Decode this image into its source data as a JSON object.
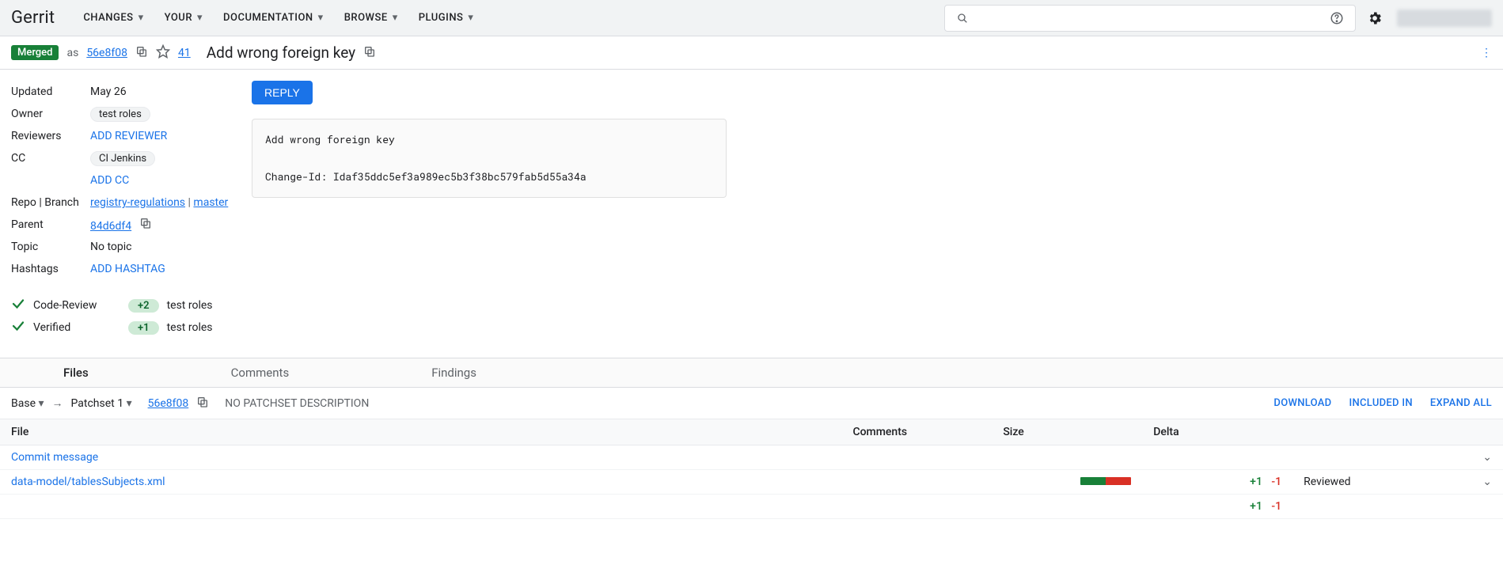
{
  "header": {
    "brand": "Gerrit",
    "nav": [
      "CHANGES",
      "YOUR",
      "DOCUMENTATION",
      "BROWSE",
      "PLUGINS"
    ],
    "search_placeholder": ""
  },
  "change": {
    "status": "Merged",
    "as_prefix": "as",
    "commit_short": "56e8f08",
    "star_count": "41",
    "title": "Add wrong foreign key"
  },
  "meta": {
    "updated_label": "Updated",
    "updated_value": "May 26",
    "owner_label": "Owner",
    "owner_value": "test roles",
    "reviewers_label": "Reviewers",
    "reviewers_action": "ADD REVIEWER",
    "cc_label": "CC",
    "cc_value": "CI Jenkins",
    "cc_action": "ADD CC",
    "repo_label": "Repo | Branch",
    "repo_value": "registry-regulations",
    "branch_value": "master",
    "parent_label": "Parent",
    "parent_value": "84d6df4",
    "topic_label": "Topic",
    "topic_value": "No topic",
    "hashtags_label": "Hashtags",
    "hashtags_action": "ADD HASHTAG"
  },
  "votes": {
    "code_review_label": "Code-Review",
    "code_review_score": "+2",
    "code_review_by": "test roles",
    "verified_label": "Verified",
    "verified_score": "+1",
    "verified_by": "test roles"
  },
  "reply_label": "REPLY",
  "commit_message": "Add wrong foreign key\n\nChange-Id: Idaf35ddc5ef3a989ec5b3f38bc579fab5d55a34a",
  "tabs": {
    "files": "Files",
    "comments": "Comments",
    "findings": "Findings"
  },
  "patchset": {
    "base_label": "Base",
    "patchset_label": "Patchset 1",
    "sha": "56e8f08",
    "no_desc": "NO PATCHSET DESCRIPTION",
    "actions": {
      "download": "DOWNLOAD",
      "included": "INCLUDED IN",
      "expand": "EXPAND ALL"
    }
  },
  "files_table": {
    "headers": {
      "file": "File",
      "comments": "Comments",
      "size": "Size",
      "delta": "Delta"
    },
    "rows": [
      {
        "name": "Commit message",
        "comments": "",
        "size_add_pct": 0,
        "size_del_pct": 0,
        "delta_add": "",
        "delta_del": "",
        "status": ""
      },
      {
        "name": "data-model/tablesSubjects.xml",
        "comments": "",
        "size_add_pct": 50,
        "size_del_pct": 50,
        "delta_add": "+1",
        "delta_del": "-1",
        "status": "Reviewed"
      }
    ],
    "totals": {
      "delta_add": "+1",
      "delta_del": "-1"
    }
  }
}
